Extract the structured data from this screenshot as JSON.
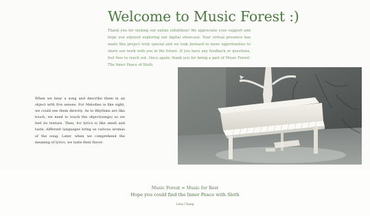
{
  "header": {
    "title": "Welcome to Music Forest :)",
    "intro": "Thank you for visiting our online exhibition! We appreciate your support and hope you enjoyed exploring our digital showcase. Your virtual presence has made this project truly special and we look forward to more opportunities to share our work with you in the future. If you have any feedback or questions, feel free to reach out. Once again, thank you for being a part of Music Forest: The Inner Peace of Sloth."
  },
  "content": {
    "description": "When we hear a song and describe them in an object with five senses. For Melodies is like sight, we could see them directly. As to Rhythms are like touch, we need to touch the object(songs) so we feel its texture. Then, for lyrics is like smell and taste, different languages bring us various aromas of the song. Later, when we comprehend the meaning of lyrics, we taste their flavor.",
    "image": {
      "subject": "white piano sculpture with tree shadows"
    }
  },
  "footer": {
    "line1": "Music Forest = Music for Rest",
    "line2": "Hope you could find the Inner Peace with Sloth",
    "author": "Lena Chang"
  },
  "colors": {
    "title": "#4f7a43",
    "accent_text": "#6e9564",
    "body_text": "#2f3a2c",
    "background": "#fbfbf9"
  }
}
